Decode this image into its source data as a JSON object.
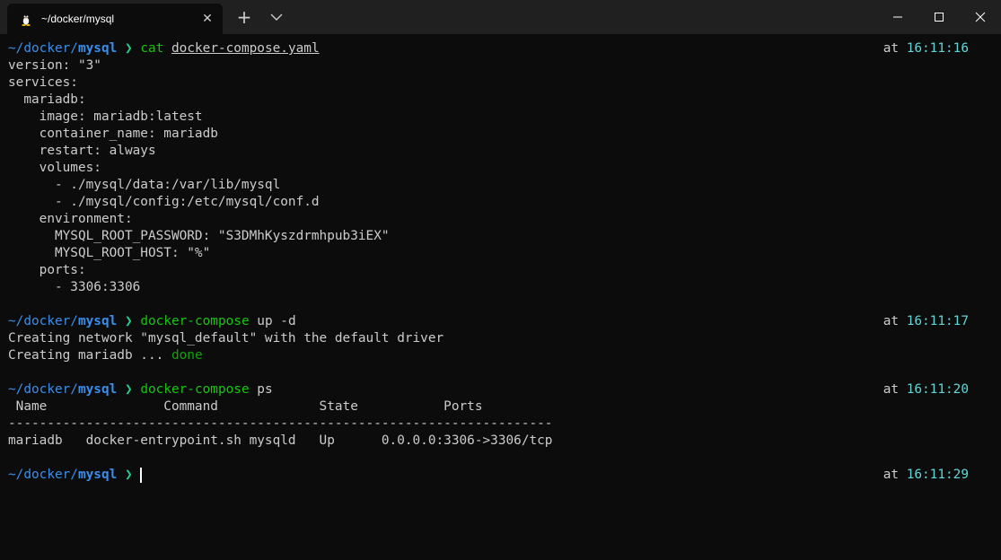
{
  "window": {
    "tab_title": "~/docker/mysql",
    "tab_icon": "linux-tux-icon",
    "close_tab_glyph": "✕",
    "new_tab_glyph": "+"
  },
  "colors": {
    "background": "#0c0c0c",
    "titlebar": "#202020",
    "path": "#3b8eea",
    "command": "#16c60c",
    "time": "#61d6d6",
    "text": "#cccccc"
  },
  "prompt": {
    "path_prefix": "~/docker/",
    "path_dir": "mysql",
    "arrow": "❯",
    "at": "at"
  },
  "blocks": [
    {
      "command": "cat",
      "args": "docker-compose.yaml",
      "time": "16:11:16",
      "output": [
        "version: \"3\"",
        "services:",
        "  mariadb:",
        "    image: mariadb:latest",
        "    container_name: mariadb",
        "    restart: always",
        "    volumes:",
        "      - ./mysql/data:/var/lib/mysql",
        "      - ./mysql/config:/etc/mysql/conf.d",
        "    environment:",
        "      MYSQL_ROOT_PASSWORD: \"S3DMhKyszdrmhpub3iEX\"",
        "      MYSQL_ROOT_HOST: \"%\"",
        "    ports:",
        "      - 3306:3306"
      ]
    },
    {
      "command": "docker-compose",
      "args": "up -d",
      "time": "16:11:17",
      "output": [
        "Creating network \"mysql_default\" with the default driver"
      ],
      "status_prefix": "Creating mariadb ... ",
      "status_done": "done"
    },
    {
      "command": "docker-compose",
      "args": "ps",
      "time": "16:11:20",
      "table_header": " Name               Command             State           Ports",
      "table_rule": "----------------------------------------------------------------------",
      "table_row": "mariadb   docker-entrypoint.sh mysqld   Up      0.0.0.0:3306->3306/tcp"
    }
  ],
  "current_prompt": {
    "time": "16:11:29"
  }
}
